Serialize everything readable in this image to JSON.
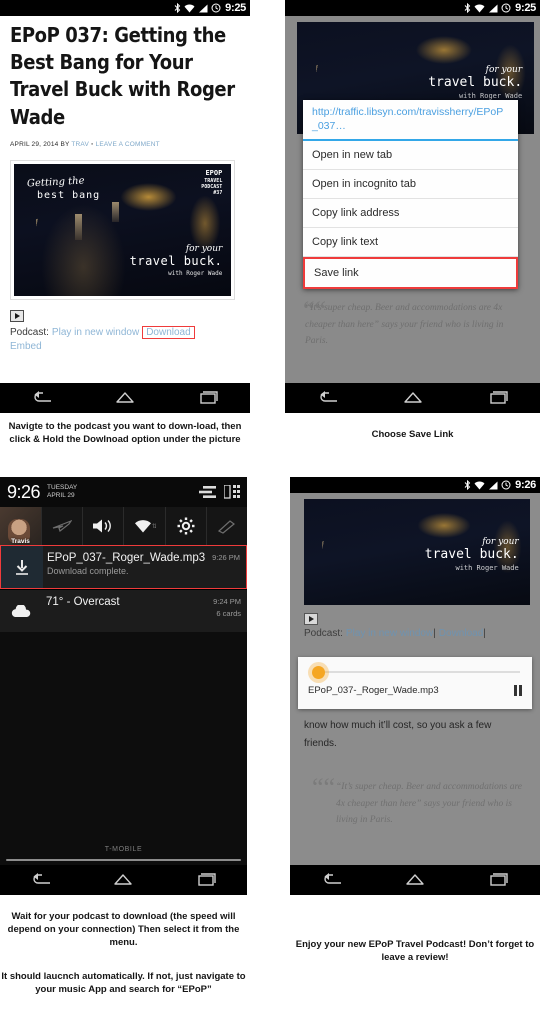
{
  "panel1": {
    "statusbar": {
      "clock": "9:25",
      "icons": [
        "bluetooth-icon",
        "wifi-icon",
        "signal-icon",
        "alarm-icon"
      ]
    },
    "article": {
      "title": "EPoP 037: Getting the Best Bang for Your Travel Buck with Roger Wade",
      "meta_date": "APRIL 29, 2014",
      "meta_by": "BY",
      "meta_author": "TRAV",
      "meta_sep": "▪",
      "meta_comment": "LEAVE A COMMENT"
    },
    "artwork": {
      "title_line1": "Getting the",
      "title_line2": "best bang",
      "sub_line1": "for your",
      "sub_line2": "travel buck.",
      "sub_line3": "with Roger Wade",
      "badge_line1": "EPOP",
      "badge_line2": "TRAVEL",
      "badge_line3": "PODCAST",
      "badge_line4": "#37"
    },
    "podcast_row": {
      "label": "Podcast:",
      "play_link": "Play in new window",
      "download_link": "Download",
      "embed_link": "Embed"
    },
    "caption": "Navigte to the podcast you want to down-load, then click & Hold the Dowlnoad option under the picture"
  },
  "panel2": {
    "statusbar": {
      "clock": "9:25"
    },
    "hero": {
      "l1": "for your",
      "l2": "travel buck.",
      "l3": "with Roger Wade"
    },
    "context_menu": {
      "url": "http://traffic.libsyn.com/travissherry/EPoP_037…",
      "items": [
        {
          "label": "Open in new tab",
          "highlighted": false
        },
        {
          "label": "Open in incognito tab",
          "highlighted": false
        },
        {
          "label": "Copy link address",
          "highlighted": false
        },
        {
          "label": "Copy link text",
          "highlighted": false
        },
        {
          "label": "Save link",
          "highlighted": true
        }
      ]
    },
    "quote": "“It’s super cheap.  Beer and accommodations are 4x cheaper than here” says your friend who is living in Paris.",
    "caption": "Choose Save Link"
  },
  "panel3": {
    "shade": {
      "time": "9:26",
      "date_line1": "TUESDAY",
      "date_line2": "APRIL 29",
      "avatar_name": "Travis",
      "quick_settings": [
        "airplane-mode-icon",
        "volume-icon",
        "wifi-icon",
        "settings-gear-icon",
        "flashlight-icon"
      ]
    },
    "notifications": [
      {
        "icon": "download-icon",
        "title": "EPoP_037-_Roger_Wade.mp3",
        "subtitle": "Download complete.",
        "time": "9:26 PM",
        "extra": "",
        "highlighted": true
      },
      {
        "icon": "cloud-icon",
        "title": "71° - Overcast",
        "subtitle": "",
        "time": "9:24 PM",
        "extra": "6 cards",
        "highlighted": false
      }
    ],
    "carrier": "T-MOBILE",
    "caption_line1": "Wait for your podcast to download (the speed will depend on your connection) Then select it from the menu.",
    "caption_line2": "It should laucnch automatically. If not, just navigate to your music App and search for “EPoP”"
  },
  "panel4": {
    "statusbar": {
      "clock": "9:26"
    },
    "hero": {
      "l1": "for your",
      "l2": "travel buck.",
      "l3": "with Roger Wade"
    },
    "podcast_row": {
      "label": "Podcast:",
      "play_link": "Play in new window",
      "sep1": "|",
      "download_link": "Download",
      "sep2": "|"
    },
    "player": {
      "filename": "EPoP_037-_Roger_Wade.mp3",
      "state": "playing",
      "progress_percent": 3,
      "accent_color": "#f5a623"
    },
    "body_text": "know how much it’ll cost, so you ask a few friends.",
    "quote": "“It’s super cheap.  Beer and accommodations are 4x cheaper than here” says your friend who is living in Paris.",
    "caption": "Enjoy your new EPoP Travel Podcast! Don’t forget to leave a review!"
  },
  "navbar": {
    "back": "back-icon",
    "home": "home-icon",
    "recents": "recent-apps-icon"
  },
  "colors": {
    "highlight": "#ef3b3b",
    "link": "#8fb6d6",
    "menu_url": "#4a9fe0",
    "accent": "#f5a623"
  }
}
